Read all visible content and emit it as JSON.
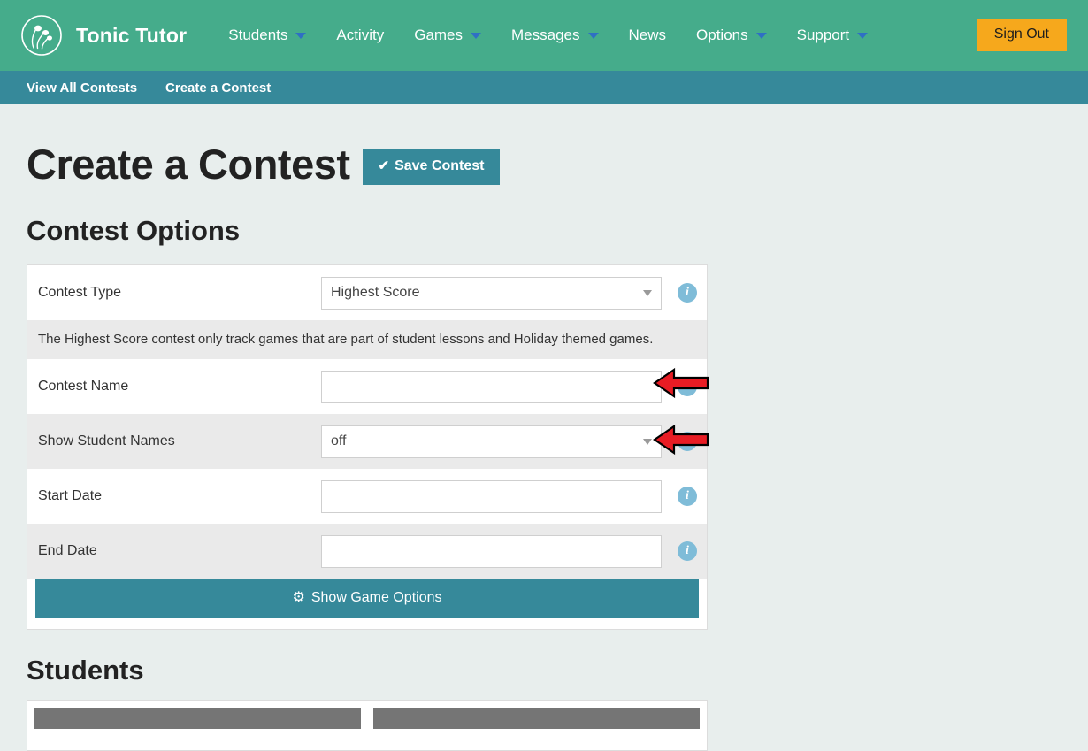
{
  "header": {
    "brand": "Tonic Tutor",
    "logo_icon": "tonic-tutor-logo",
    "nav": [
      {
        "label": "Students",
        "has_caret": true
      },
      {
        "label": "Activity",
        "has_caret": false
      },
      {
        "label": "Games",
        "has_caret": true
      },
      {
        "label": "Messages",
        "has_caret": true
      },
      {
        "label": "News",
        "has_caret": false
      },
      {
        "label": "Options",
        "has_caret": true
      },
      {
        "label": "Support",
        "has_caret": true
      }
    ],
    "sign_out": "Sign Out",
    "colors": {
      "header_bg": "#45ac8b",
      "subnav_bg": "#36899a",
      "sign_out_bg": "#f6a81c",
      "caret": "#2f6fc4"
    }
  },
  "subnav": {
    "items": [
      {
        "label": "View All Contests"
      },
      {
        "label": "Create a Contest"
      }
    ]
  },
  "page": {
    "title": "Create a Contest",
    "save_button": "Save Contest",
    "save_icon": "check-icon",
    "section_title": "Contest Options",
    "students_title": "Students",
    "page_bg": "#e8eeed"
  },
  "form": {
    "rows": [
      {
        "label": "Contest Type",
        "type": "select",
        "value": "Highest Score",
        "info_icon": "info-icon"
      },
      {
        "label": "Contest Name",
        "type": "text",
        "value": "",
        "placeholder": "",
        "info_icon": "info-icon"
      },
      {
        "label": "Show Student Names",
        "type": "select",
        "value": "off",
        "info_icon": "info-icon"
      },
      {
        "label": "Start Date",
        "type": "text",
        "value": "",
        "placeholder": "",
        "info_icon": "info-icon"
      },
      {
        "label": "End Date",
        "type": "text",
        "value": "",
        "placeholder": "",
        "info_icon": "info-icon"
      }
    ],
    "note": "The Highest Score contest only track games that are part of student lessons and Holiday themed games.",
    "game_options_button": "Show Game Options",
    "game_options_icon": "gear-icon"
  },
  "annotations": {
    "arrow_color": "#e81c24",
    "arrow_outline": "#000000",
    "arrows": [
      {
        "name": "arrow-contest-name",
        "points_to": "Contest Name field"
      },
      {
        "name": "arrow-show-student-names",
        "points_to": "Show Student Names field"
      }
    ]
  }
}
